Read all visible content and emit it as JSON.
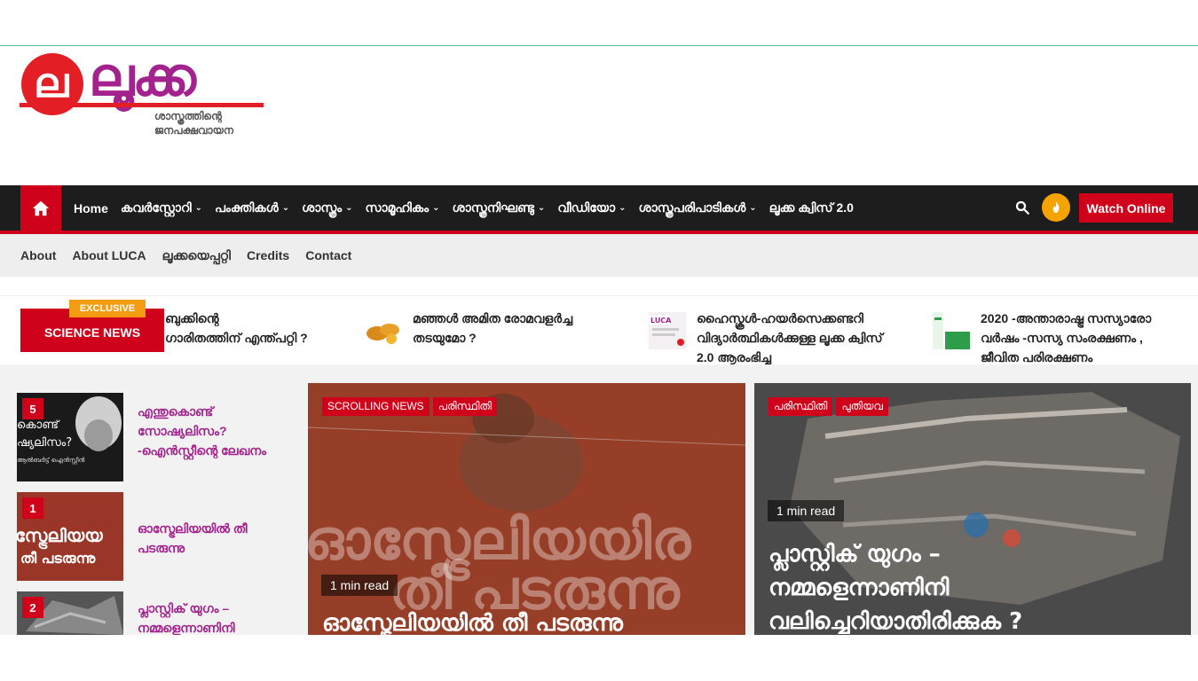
{
  "logo": {
    "glyph": "ല",
    "word": "ലൂക്ക",
    "tagline1": "ശാസ്ത്രത്തിന്റെ",
    "tagline2": "ജനപക്ഷവായന"
  },
  "mainnav": {
    "items": [
      {
        "label": "Home",
        "dropdown": false
      },
      {
        "label": "കവർസ്റ്റോറി",
        "dropdown": true
      },
      {
        "label": "പംക്തികൾ",
        "dropdown": true
      },
      {
        "label": "ശാസ്ത്രം",
        "dropdown": true
      },
      {
        "label": "സാമൂഹികം",
        "dropdown": true
      },
      {
        "label": "ശാസ്ത്രനിഘണ്ടു",
        "dropdown": true
      },
      {
        "label": "വീഡിയോ",
        "dropdown": true
      },
      {
        "label": "ശാസ്ത്രപരിപാടികൾ",
        "dropdown": true
      },
      {
        "label": "ലൂക്ക ക്വിസ് 2.0",
        "dropdown": false
      }
    ],
    "chevron": "⌄",
    "watch_label": "Watch Online",
    "colors": {
      "accent": "#d0021b",
      "bar": "#1d1d1d",
      "flame": "#f5a300"
    }
  },
  "subnav": {
    "items": [
      "About",
      "About LUCA",
      "ലൂക്കയെപ്പറ്റി",
      "Credits",
      "Contact"
    ]
  },
  "ticker": {
    "label": "SCIENCE NEWS",
    "badge": "EXCLUSIVE",
    "items": [
      {
        "line1": "ബുക്കിന്റെ",
        "line2": "ഗാരിതത്തിന് എന്ത്പറ്റി ?"
      },
      {
        "line1": "മഞ്ഞൾ അമിത രോമവളർച്ച",
        "line2": "തടയുമോ ?"
      },
      {
        "line1": "ഹൈസ്കൂൾ-ഹയർസെക്കണ്ടറി",
        "line2": "വിദ്യാർത്ഥികൾക്കുള്ള ലൂക്ക ക്വിസ്",
        "line3": "2.0 ആരംഭിച്ചു",
        "thumb_label": "LUCA"
      },
      {
        "line1": "2020 -അന്താരാഷ്ട്ര സസ്യാരോ",
        "line2": "വർഷം -സസ്യ സംരക്ഷണം ,",
        "line3": "ജീവിത പരിരക്ഷണം"
      }
    ]
  },
  "sidebar": {
    "items": [
      {
        "num": "5",
        "title": "എന്തുകൊണ്ട് സോഷ്യലിസം? -ഐൻസ്റ്റീന്റെ ലേഖനം",
        "thumb_text1": "കൊണ്ട്",
        "thumb_text2": "ഷ്യലിസം?",
        "thumb_text3": "ആൽബർട്ട് ഐൻസ്റ്റീൻ"
      },
      {
        "num": "1",
        "title": "ഓസ്ട്രേലിയയിൽ തീ പടരുന്നു",
        "thumb_text1": "സ്ട്രേലിയയ",
        "thumb_text2": "തീ പടരുന്നു"
      },
      {
        "num": "2",
        "title": "പ്ലാസ്റ്റിക് യുഗം – നമ്മളെന്നാണിനി"
      }
    ]
  },
  "cards": [
    {
      "tags": [
        "SCROLLING NEWS",
        "പരിസ്ഥിതി"
      ],
      "read": "1 min read",
      "big_line1": "ഓസ്ട്രേലിയയിര",
      "big_line2": "തീ പടരുന്നു",
      "title": "ഓസ്ട്രേലിയയിൽ തീ പടരുന്നു"
    },
    {
      "tags": [
        "പരിസ്ഥിതി",
        "പുതിയവ"
      ],
      "read": "1 min read",
      "title_line1": "പ്ലാസ്റ്റിക് യുഗം –",
      "title_line2": "നമ്മളെന്നാണിനി",
      "title_line3": "വലിച്ചെറിയാതിരിക്കുക ?"
    }
  ]
}
